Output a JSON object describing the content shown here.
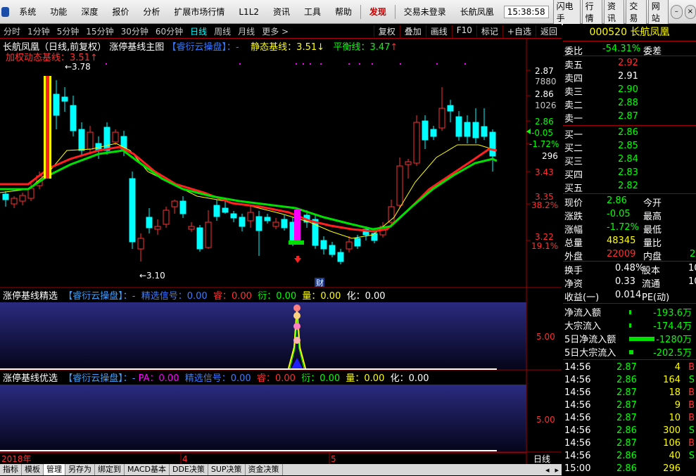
{
  "menu": {
    "items": [
      "系统",
      "功能",
      "深度",
      "报价",
      "分析",
      "扩展市场行情",
      "L1L2",
      "资讯",
      "工具",
      "帮助"
    ],
    "hot": "发现",
    "login": "交易未登录",
    "stock": "长航凤凰",
    "time": "15:38:58",
    "right_buttons": [
      "闪电手",
      "行情",
      "资讯",
      "交易",
      "网站"
    ]
  },
  "periods": [
    "分时",
    "1分钟",
    "5分钟",
    "15分钟",
    "30分钟",
    "60分钟",
    "日线",
    "周线",
    "月线",
    "更多 >"
  ],
  "active_period": "日线",
  "tools": [
    "复权",
    "叠加",
    "画线",
    "F10",
    "标记",
    "+自选",
    "返回"
  ],
  "main": {
    "name": "长航凤凰（日线,前复权）",
    "indicator": "涨停基线主图",
    "tag": "【睿衍云操盘】：-",
    "static_label": "静态基线：3.51",
    "static_arrow": "↓",
    "balance_label": "平衡线：3.47",
    "balance_arrow": "↑",
    "sub_label": "加权动态基线：3.51",
    "sub_arrow": "↑",
    "high_label": "←3.78",
    "low_label": "←3.10",
    "cai_label": "财"
  },
  "axis_right": [
    "2.87",
    "7880",
    "2.86",
    "1026",
    "2.86",
    "-0.05",
    "-1.72%",
    "296",
    "3.43",
    "3.35",
    "38.2%",
    "3.22",
    "19.1%"
  ],
  "pane1": {
    "title": "涨停基线精选",
    "tag": "【睿衍云操盘】：-",
    "sig": "精选信号：0.00",
    "rui": "睿：0.00",
    "yan": "衍：0.00",
    "liang": "量：0.00",
    "hua": "化：0.00",
    "axis": "5.00"
  },
  "pane2": {
    "title": "涨停基线优选",
    "tag": "【睿衍云操盘】：-",
    "pa": "PA：0.00",
    "sig": "精选信号：0.00",
    "rui": "睿：0.00",
    "yan": "衍：0.00",
    "liang": "量：0.00",
    "hua": "化：0.00",
    "axis": "5.00"
  },
  "xaxis": {
    "year": "2018年",
    "m4": "4",
    "m5": "5",
    "right": "日线"
  },
  "bottom_tabs": [
    "指标",
    "模板",
    "管理",
    "另存为",
    "绑定到",
    "MACD基本",
    "DDE决策",
    "SUP决策",
    "资金决策"
  ],
  "active_tab": "管理",
  "quote": {
    "code_name": "000520 长航凤凰",
    "weibi_label": "委比",
    "weibi": "-54.31%",
    "weicha_label": "委差",
    "sells": [
      [
        "卖五",
        "2.92"
      ],
      [
        "卖四",
        "2.91"
      ],
      [
        "卖三",
        "2.90"
      ],
      [
        "卖二",
        "2.88"
      ],
      [
        "卖一",
        "2.87"
      ]
    ],
    "buys": [
      [
        "买一",
        "2.86"
      ],
      [
        "买二",
        "2.85"
      ],
      [
        "买三",
        "2.84"
      ],
      [
        "买四",
        "2.83"
      ],
      [
        "买五",
        "2.82"
      ]
    ],
    "stats": [
      [
        "现价",
        "2.86",
        "今开",
        ""
      ],
      [
        "涨跌",
        "-0.05",
        "最高",
        ""
      ],
      [
        "涨幅",
        "-1.72%",
        "最低",
        ""
      ],
      [
        "总量",
        "48345",
        "量比",
        ""
      ],
      [
        "外盘",
        "22009",
        "内盘",
        "2"
      ]
    ],
    "stats2": [
      [
        "换手",
        "0.48%",
        "股本",
        "10"
      ],
      [
        "净资",
        "0.33",
        "流通",
        "10"
      ],
      [
        "收益(一)",
        "0.014",
        "PE(动)",
        ""
      ]
    ],
    "flows": [
      [
        "净流入额",
        "-193.6万"
      ],
      [
        "大宗流入",
        "-174.4万"
      ],
      [
        "5日净流入额",
        "-1280万"
      ],
      [
        "5日大宗流入",
        "-202.5万"
      ]
    ],
    "ticks": [
      [
        "14:56",
        "2.87",
        "4",
        "B"
      ],
      [
        "14:56",
        "2.86",
        "164",
        "S"
      ],
      [
        "14:56",
        "2.87",
        "18",
        "B"
      ],
      [
        "14:56",
        "2.87",
        "9",
        "B"
      ],
      [
        "14:56",
        "2.87",
        "10",
        "B"
      ],
      [
        "14:56",
        "2.86",
        "300",
        "S"
      ],
      [
        "14:56",
        "2.87",
        "106",
        "B"
      ],
      [
        "14:56",
        "2.86",
        "40",
        "S"
      ],
      [
        "15:00",
        "2.86",
        "296",
        ""
      ]
    ]
  },
  "colors": {
    "up": "#ff3030",
    "down": "#00ffff",
    "ma_fast": "#ffff00",
    "ma_mid": "#ff2020",
    "ma_slow": "#00e000"
  }
}
